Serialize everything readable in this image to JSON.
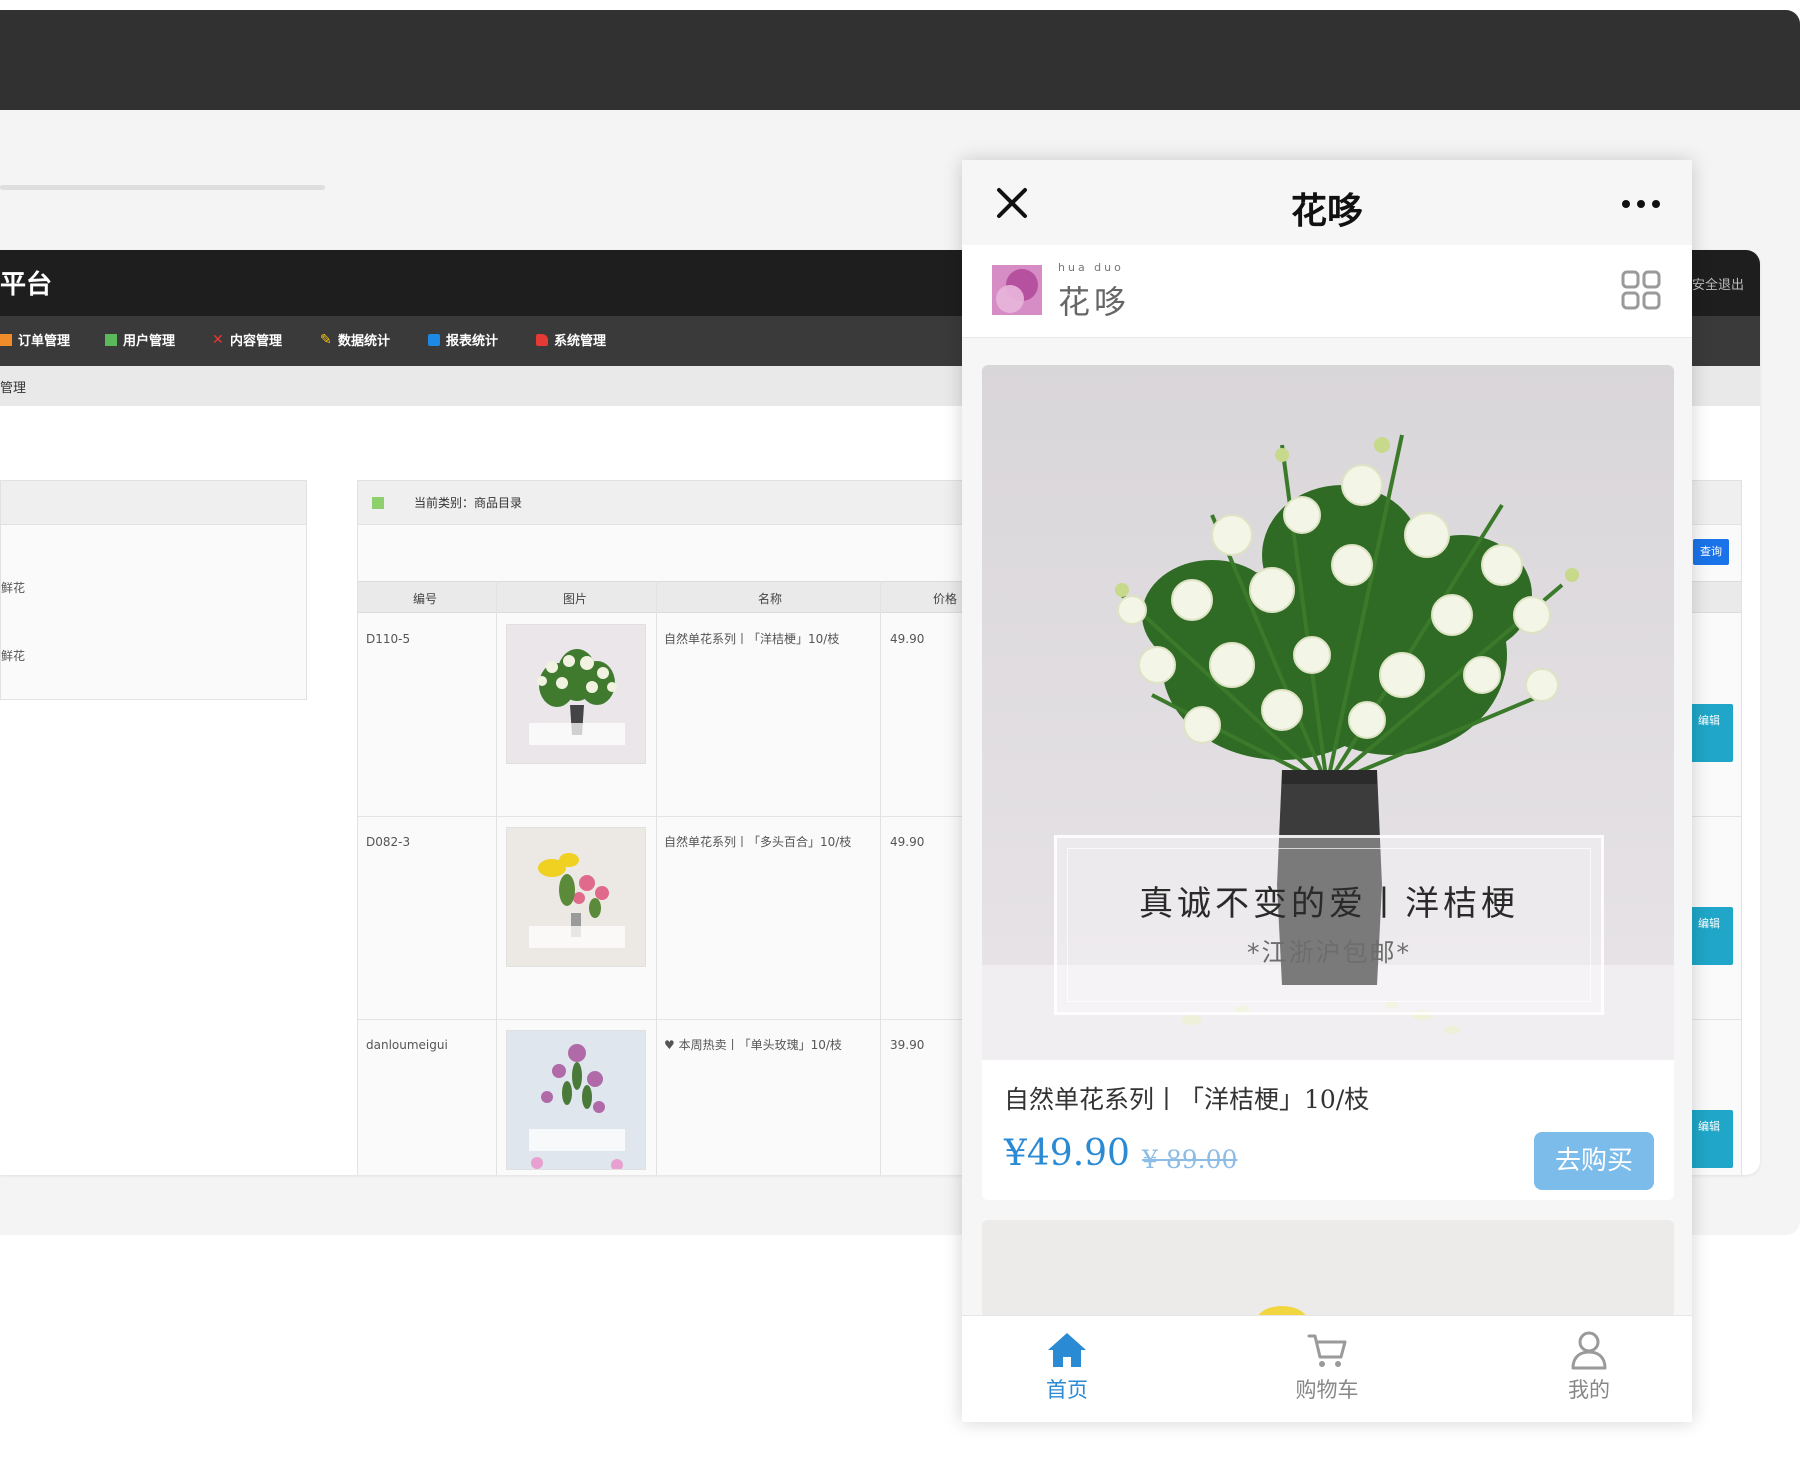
{
  "admin": {
    "title": "平台",
    "logout": "安全退出",
    "nav": [
      {
        "label": "订单管理",
        "color": "#f28c28"
      },
      {
        "label": "用户管理",
        "color": "#5cb85c"
      },
      {
        "label": "内容管理",
        "color": "#e53935"
      },
      {
        "label": "数据统计",
        "color": "#f5c518"
      },
      {
        "label": "报表统计",
        "color": "#1e88e5"
      },
      {
        "label": "系统管理",
        "color": "#e53935"
      }
    ],
    "breadcrumb": "管理",
    "tree": [
      "鲜花",
      "鲜花"
    ],
    "current_category": "当前类别：商品目录",
    "search_label": "查询",
    "columns": [
      "编号",
      "图片",
      "名称",
      "价格"
    ],
    "rows": [
      {
        "id": "D110-5",
        "name": "自然单花系列丨「洋桔梗」10/枝",
        "price": "49.90",
        "edit": "编辑"
      },
      {
        "id": "D082-3",
        "name": "自然单花系列丨「多头百合」10/枝",
        "price": "49.90",
        "edit": "编辑"
      },
      {
        "id": "danloumeigui",
        "name": "♥ 本周热卖丨「单头玫瑰」10/枝",
        "price": "39.90",
        "edit": "编辑"
      }
    ]
  },
  "app": {
    "title": "花哆",
    "brand": {
      "pinyin": "hua  duo",
      "name": "花哆"
    },
    "product": {
      "banner_title": "真诚不变的爱丨洋桔梗",
      "banner_sub": "*江浙沪包邮*",
      "name": "自然单花系列丨「洋桔梗」10/枝",
      "price": "¥49.90",
      "original_price": "¥ 89.00",
      "buy_label": "去购买"
    },
    "tabs": [
      {
        "label": "首页",
        "icon": "home-icon",
        "active": true
      },
      {
        "label": "购物车",
        "icon": "cart-icon",
        "active": false
      },
      {
        "label": "我的",
        "icon": "user-icon",
        "active": false
      }
    ],
    "accent_color": "#2a8ad4"
  }
}
